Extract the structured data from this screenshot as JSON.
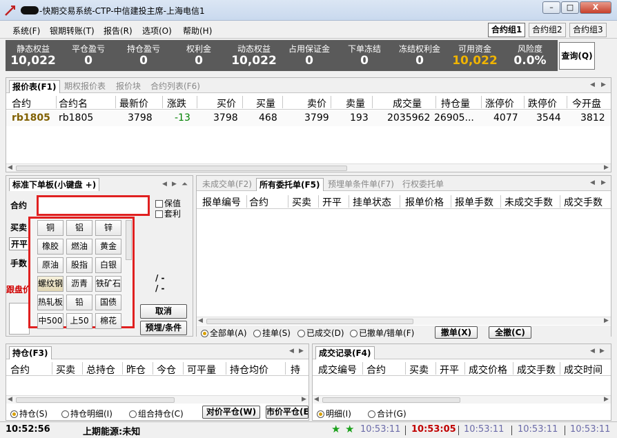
{
  "window": {
    "title": "-快期交易系统-CTP-中信建投主席-上海电信1",
    "min_label": "–",
    "max_label": "□",
    "close_label": "X"
  },
  "menu": [
    "系统(F)",
    "银期转账(T)",
    "报告(R)",
    "选项(O)",
    "帮助(H)"
  ],
  "contract_groups": [
    "合约组1",
    "合约组2",
    "合约组3"
  ],
  "stats": [
    {
      "label": "静态权益",
      "value": "10,022"
    },
    {
      "label": "平仓盈亏",
      "value": "0"
    },
    {
      "label": "持仓盈亏",
      "value": "0"
    },
    {
      "label": "权利金",
      "value": "0"
    },
    {
      "label": "动态权益",
      "value": "10,022"
    },
    {
      "label": "占用保证金",
      "value": "0"
    },
    {
      "label": "下单冻结",
      "value": "0"
    },
    {
      "label": "冻结权利金",
      "value": "0"
    },
    {
      "label": "可用资金",
      "value": "10,022"
    },
    {
      "label": "风险度",
      "value": "0.0%"
    }
  ],
  "query_button": "查询(Q)",
  "quote_tabs": [
    "报价表(F1)",
    "期权报价表",
    "报价块",
    "合约列表(F6)"
  ],
  "quote_headers": [
    "合约",
    "合约名",
    "最新价",
    "涨跌",
    "买价",
    "买量",
    "卖价",
    "卖量",
    "成交量",
    "持仓量",
    "涨停价",
    "跌停价",
    "今开盘"
  ],
  "quote_row": [
    "rb1805",
    "rb1805",
    "3798",
    "-13",
    "3798",
    "468",
    "3799",
    "193",
    "2035962",
    "26905...",
    "4077",
    "3544",
    "3812"
  ],
  "order_panel": {
    "tab": "标准下单板(小键盘 +)",
    "contract_label": "合约",
    "contract_value": "",
    "hedge_label": "保值",
    "arbitrage_label": "套利",
    "buysell_label": "买卖",
    "openclose_label": "开平",
    "qty_label": "手数",
    "follow_label": "跟盘价",
    "slash1": "/ -",
    "slash2": "/ -",
    "cancel_button": "取消",
    "preorder_button": "预埋/条件"
  },
  "keyboard": [
    [
      "铜",
      "铝",
      "锌"
    ],
    [
      "橡胶",
      "燃油",
      "黄金"
    ],
    [
      "原油",
      "股指",
      "白银"
    ],
    [
      "螺纹钢",
      "沥青",
      "铁矿石"
    ],
    [
      "热轧板",
      "铅",
      "国债"
    ],
    [
      "中500",
      "上50",
      "棉花"
    ]
  ],
  "orders": {
    "tabs": [
      "未成交单(F2)",
      "所有委托单(F5)",
      "预埋单条件单(F7)",
      "行权委托单"
    ],
    "headers": [
      "报单编号",
      "合约",
      "买卖",
      "开平",
      "挂单状态",
      "报单价格",
      "报单手数",
      "未成交手数",
      "成交手数"
    ],
    "filters": [
      "全部单(A)",
      "挂单(S)",
      "已成交(D)",
      "已撤单/错单(F)"
    ],
    "cancel_button": "撤单(X)",
    "cancel_all_button": "全撤(C)"
  },
  "positions": {
    "tab": "持仓(F3)",
    "headers": [
      "合约",
      "买卖",
      "总持仓",
      "昨仓",
      "今仓",
      "可平量",
      "持仓均价",
      "持"
    ],
    "options": [
      "持仓(S)",
      "持仓明细(I)",
      "组合持仓(C)"
    ],
    "counter_close_button": "对价平仓(W)",
    "market_close_button": "市价平仓(E)"
  },
  "trades": {
    "tab": "成交记录(F4)",
    "headers": [
      "成交编号",
      "合约",
      "买卖",
      "开平",
      "成交价格",
      "成交手数",
      "成交时间"
    ],
    "options": [
      "明细(I)",
      "合计(G)"
    ]
  },
  "statusbar": {
    "clock": "10:52:56",
    "source": "上期能源:未知",
    "times": [
      "10:53:11",
      "10:53:05",
      "10:53:11",
      "10:53:11",
      "10:53:11"
    ]
  },
  "colors": {
    "stats_bg": "#5a5a5a",
    "available_funds": "#f0b400",
    "change_down": "#008000",
    "highlight_box": "#e02020"
  }
}
